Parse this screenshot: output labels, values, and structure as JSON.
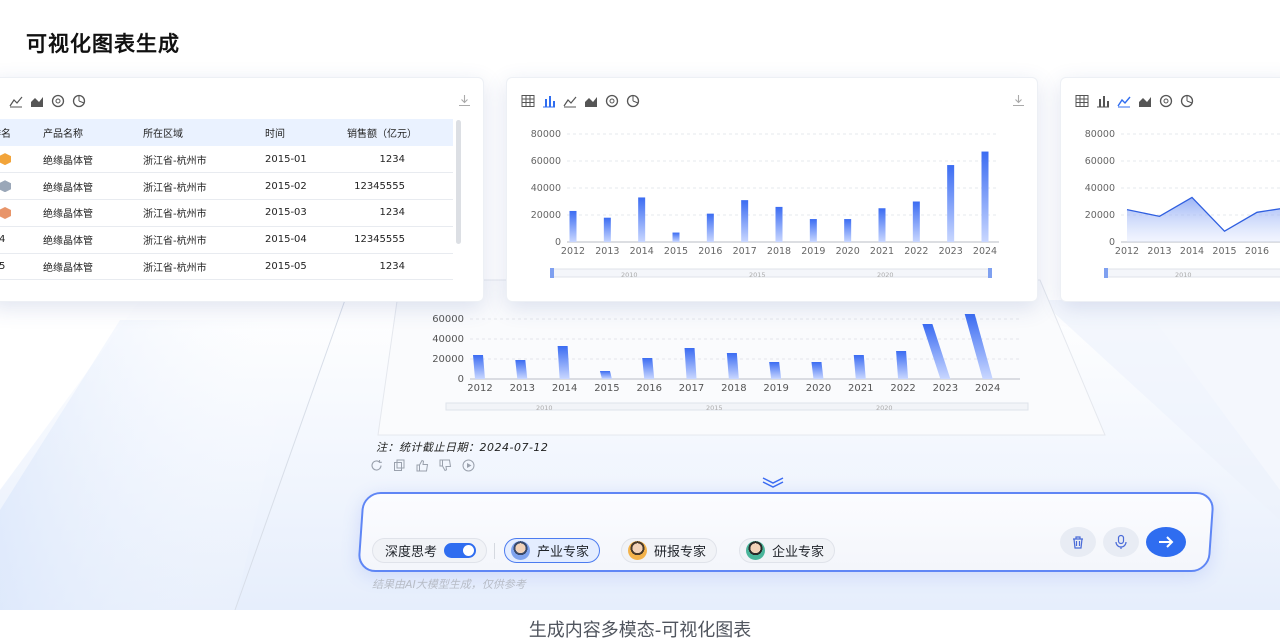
{
  "page": {
    "title": "可视化图表生成",
    "caption": "生成内容多模态-可视化图表"
  },
  "table_card": {
    "headers": [
      "排名",
      "产品名称",
      "所在区域",
      "时间",
      "销售额（亿元）"
    ],
    "rows": [
      {
        "rank": "1",
        "product": "绝缘晶体管",
        "region": "浙江省-杭州市",
        "time": "2015-01",
        "sales": "1234"
      },
      {
        "rank": "2",
        "product": "绝缘晶体管",
        "region": "浙江省-杭州市",
        "time": "2015-02",
        "sales": "12345555"
      },
      {
        "rank": "3",
        "product": "绝缘晶体管",
        "region": "浙江省-杭州市",
        "time": "2015-03",
        "sales": "1234"
      },
      {
        "rank": "4",
        "product": "绝缘晶体管",
        "region": "浙江省-杭州市",
        "time": "2015-04",
        "sales": "12345555"
      },
      {
        "rank": "5",
        "product": "绝缘晶体管",
        "region": "浙江省-杭州市",
        "time": "2015-05",
        "sales": "1234"
      }
    ],
    "badge_colors": [
      "#f2a43a",
      "#9aa7b8",
      "#e8956a"
    ]
  },
  "chart_data": [
    {
      "type": "bar",
      "categories": [
        "2012",
        "2013",
        "2014",
        "2015",
        "2016",
        "2017",
        "2018",
        "2019",
        "2020",
        "2021",
        "2022",
        "2023",
        "2024"
      ],
      "values": [
        23000,
        18000,
        33000,
        7000,
        21000,
        31000,
        26000,
        17000,
        17000,
        25000,
        30000,
        57000,
        67000
      ],
      "yticks": [
        "0",
        "20000",
        "40000",
        "60000",
        "80000"
      ],
      "ylim": [
        0,
        80000
      ],
      "zoom_labels": [
        "2010",
        "2015",
        "2020"
      ]
    },
    {
      "type": "area",
      "categories": [
        "2012",
        "2013",
        "2014",
        "2015",
        "2016"
      ],
      "values": [
        24000,
        19000,
        33000,
        8000,
        22000
      ],
      "yticks": [
        "0",
        "20000",
        "40000",
        "60000",
        "80000"
      ],
      "ylim": [
        0,
        80000
      ],
      "zoom_labels": [
        "2010"
      ]
    },
    {
      "type": "bar",
      "categories": [
        "2012",
        "2013",
        "2014",
        "2015",
        "2016",
        "2017",
        "2018",
        "2019",
        "2020",
        "2021",
        "2022",
        "2023",
        "2024"
      ],
      "values": [
        24000,
        19000,
        33000,
        8000,
        21000,
        31000,
        26000,
        17000,
        17000,
        24000,
        28000,
        55000,
        65000
      ],
      "yticks": [
        "0",
        "20000",
        "40000",
        "60000"
      ],
      "ylim": [
        0,
        65000
      ],
      "zoom_labels": [
        "2010",
        "2015",
        "2020"
      ]
    }
  ],
  "answer": {
    "note": "注：统计截止日期：2024-07-12"
  },
  "input": {
    "deep_think_label": "深度思考",
    "chips": [
      "产业专家",
      "研报专家",
      "企业专家"
    ],
    "disclaimer": "结果由AI大模型生成，仅供参考"
  },
  "colors": {
    "accent": "#2f6df0",
    "bar_top": "#3b6cf2",
    "bar_bottom": "#c9d7ff"
  }
}
